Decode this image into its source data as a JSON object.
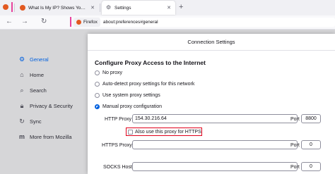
{
  "tabs": [
    {
      "label": "What Is My IP? Shows Your Public IP"
    },
    {
      "label": "Settings"
    }
  ],
  "navbar": {
    "identity_label": "Firefox",
    "url": "about:preferences#general"
  },
  "sidebar": {
    "items": [
      {
        "label": "General",
        "icon": "gear-icon",
        "active": true
      },
      {
        "label": "Home",
        "icon": "home-icon"
      },
      {
        "label": "Search",
        "icon": "search-icon"
      },
      {
        "label": "Privacy & Security",
        "icon": "lock-icon"
      },
      {
        "label": "Sync",
        "icon": "sync-icon"
      },
      {
        "label": "More from Mozilla",
        "icon": "mozilla-icon"
      }
    ]
  },
  "dialog": {
    "title": "Connection Settings",
    "heading": "Configure Proxy Access to the Internet",
    "options": [
      {
        "label": "No proxy",
        "selected": false
      },
      {
        "label": "Auto-detect proxy settings for this network",
        "selected": false
      },
      {
        "label": "Use system proxy settings",
        "selected": false
      },
      {
        "label": "Manual proxy configuration",
        "selected": true
      }
    ],
    "http_proxy_label": "HTTP Proxy",
    "http_proxy_value": "154.30.216.64",
    "port_label": "Port",
    "http_port_value": "8800",
    "also_https_label": "Also use this proxy for HTTPS",
    "https_proxy_label": "HTTPS Proxy",
    "https_proxy_value": "",
    "https_port_value": "0",
    "socks_host_label": "SOCKS Host",
    "socks_host_value": "",
    "socks_port_value": "0"
  },
  "colors": {
    "accent": "#0060df",
    "highlight": "#e0001b"
  }
}
